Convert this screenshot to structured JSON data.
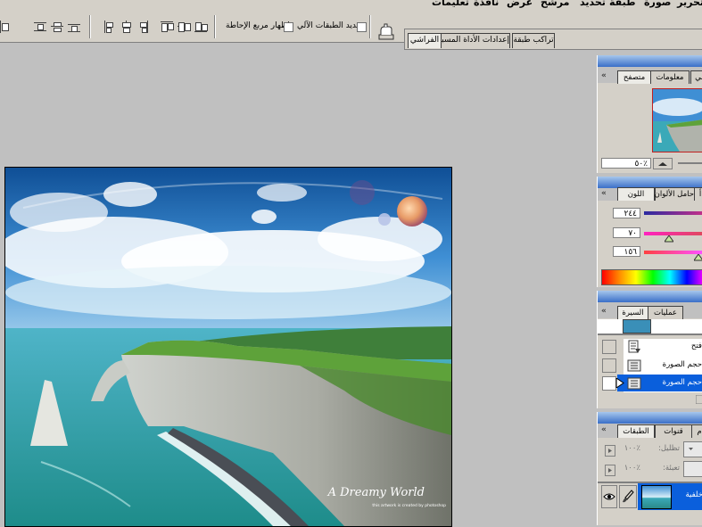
{
  "menu": [
    {
      "label": "تحرير"
    },
    {
      "label": "صورة"
    },
    {
      "label": "طبقة"
    },
    {
      "label": "تحديد"
    },
    {
      "label": "مرشح"
    },
    {
      "label": "عرض"
    },
    {
      "label": "نافذة"
    },
    {
      "label": "تعليمات"
    }
  ],
  "options": {
    "auto_select_label": "تحديد الطبقات الآلي",
    "show_bounding_box_label": "إظهار مربع الإحاطة"
  },
  "palette_well": {
    "tabs": [
      "تراكب طبقة",
      "إعدادات الأداة المسبقة",
      "الفراشي"
    ]
  },
  "document": {
    "watermark": "A Dreamy World",
    "watermark_sub": "this artwork is created by photoshop"
  },
  "navigator": {
    "tabs": [
      "متصفح",
      "معلومات",
      "اني"
    ],
    "zoom_value": "٥٠٪",
    "view_fraction": 0.5
  },
  "color": {
    "tabs": [
      "اللون",
      "حامل الألوان",
      "أ"
    ],
    "r_value": "٢٤٤",
    "g_value": "٧٠",
    "b_value": "١٥٦",
    "r_fraction": 0.957,
    "g_fraction": 0.275,
    "b_fraction": 0.612
  },
  "history": {
    "tabs": [
      "السيرة",
      "عمليات"
    ],
    "items": [
      {
        "label": "فتح",
        "selected": false
      },
      {
        "label": "حجم الصورة",
        "selected": false
      },
      {
        "label": "حجم الصورة",
        "selected": true
      }
    ]
  },
  "layers": {
    "tabs": [
      "الطبقات",
      "قنوات",
      "م"
    ],
    "opacity_label": "تظليل:",
    "opacity_value": "١٠٠٪",
    "fill_label": "تعبئة:",
    "fill_value": "١٠٠٪",
    "layer_name": "خلفية"
  },
  "colors": {
    "chrome": "#d4d0c8",
    "workspace": "#c0c0c0",
    "selection": "#0a5fdc",
    "title_start": "#a6c6ec",
    "title_end": "#3a6fc8"
  }
}
